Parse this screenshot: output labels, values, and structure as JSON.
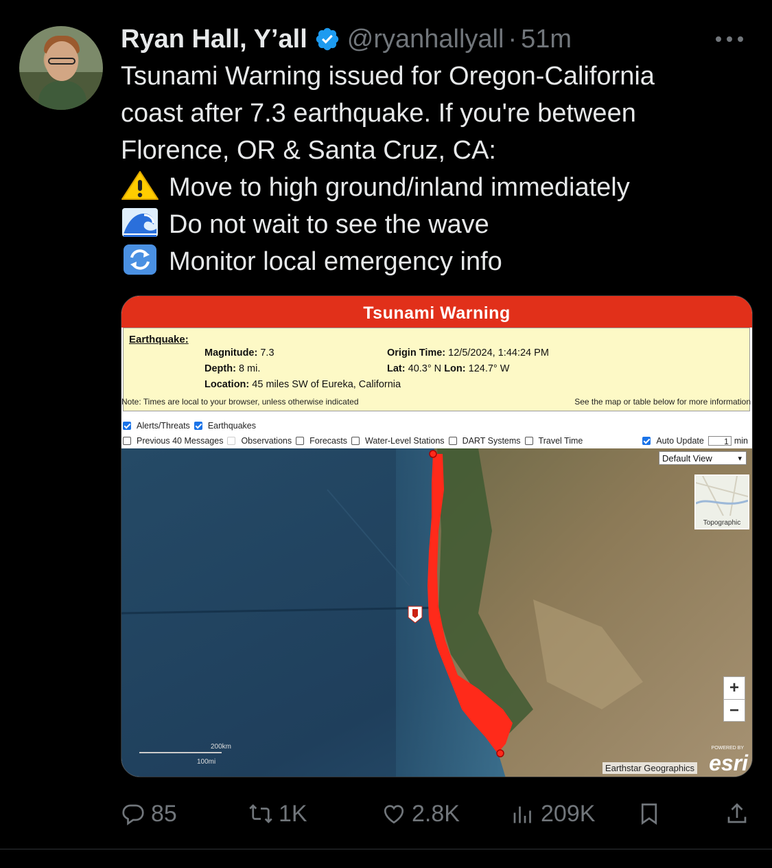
{
  "tweet": {
    "author_name": "Ryan Hall, Y’all",
    "handle": "@ryanhallyall",
    "separator": "·",
    "time": "51m",
    "lines": [
      "Tsunami Warning issued for Oregon-California",
      "coast after 7.3 earthquake. If you're between",
      "Florence, OR & Santa Cruz, CA:"
    ],
    "bullets": [
      {
        "icon": "warning-emoji",
        "text": "Move to high ground/inland immediately"
      },
      {
        "icon": "wave-emoji",
        "text": "Do not wait to see the wave"
      },
      {
        "icon": "refresh-emoji",
        "text": "Monitor local emergency info"
      }
    ]
  },
  "card": {
    "banner": "Tsunami Warning",
    "earthquake_title": "Earthquake",
    "magnitude_label": "Magnitude:",
    "magnitude": "7.3",
    "depth_label": "Depth:",
    "depth": "8 mi.",
    "location_label": "Location:",
    "location": "45 miles SW of Eureka, California",
    "origin_label": "Origin Time:",
    "origin": "12/5/2024, 1:44:24 PM",
    "lat_label": "Lat:",
    "lat": "40.3° N",
    "lon_label": "Lon:",
    "lon": "124.7° W",
    "note_left": "Note: Times are local to your browser, unless otherwise indicated",
    "note_right": "See the map or table below for more information",
    "options_row1": [
      {
        "label": "Alerts/Threats",
        "checked": true
      },
      {
        "label": "Earthquakes",
        "checked": true
      }
    ],
    "options_row2": [
      {
        "label": "Previous 40 Messages",
        "checked": false
      },
      {
        "label": "Observations",
        "checked": false
      },
      {
        "label": "Forecasts",
        "checked": false
      },
      {
        "label": "Water-Level Stations",
        "checked": false
      },
      {
        "label": "DART Systems",
        "checked": false
      },
      {
        "label": "Travel Time",
        "checked": false
      }
    ],
    "auto_update_label": "Auto Update",
    "auto_update_value": "1",
    "auto_update_unit": "min",
    "view_select": "Default View",
    "basemap_label": "Topographic",
    "zoom_in": "+",
    "zoom_out": "−",
    "attribution": "Earthstar Geographics",
    "esri": "esri",
    "powered_by": "POWERED BY",
    "scale_km": "200km",
    "scale_mi": "100mi",
    "colors": {
      "banner": "#e1301a",
      "info_bg": "#fdf9c6",
      "warning_zone": "#ff2a1a"
    }
  },
  "actions": {
    "replies": "85",
    "reposts": "1K",
    "likes": "2.8K",
    "views": "209K"
  }
}
